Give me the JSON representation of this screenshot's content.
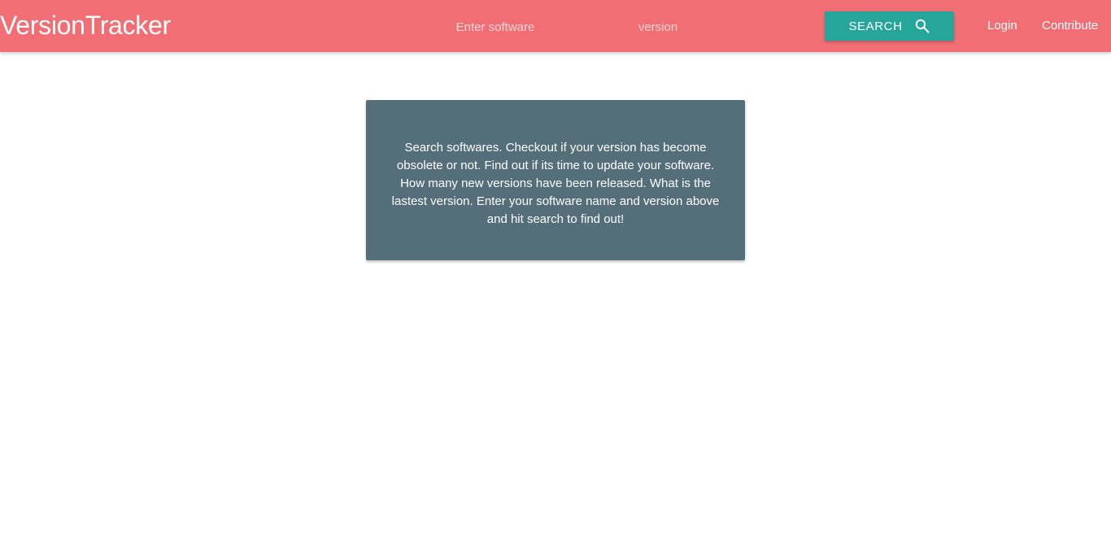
{
  "header": {
    "brand": "VersionTracker",
    "software_placeholder": "Enter software",
    "version_placeholder": "version",
    "search_label": "SEARCH",
    "search_icon": "search-icon",
    "login_label": "Login",
    "contribute_label": "Contribute"
  },
  "info_card": {
    "text": "Search softwares. Checkout if your version has become obsolete or not. Find out if its time to update your software. How many new versions have been released. What is the lastest version. Enter your software name and version above and hit search to find out!"
  },
  "colors": {
    "navbar": "#f06e74",
    "search_button": "#26a69a",
    "card": "#546e7a"
  }
}
